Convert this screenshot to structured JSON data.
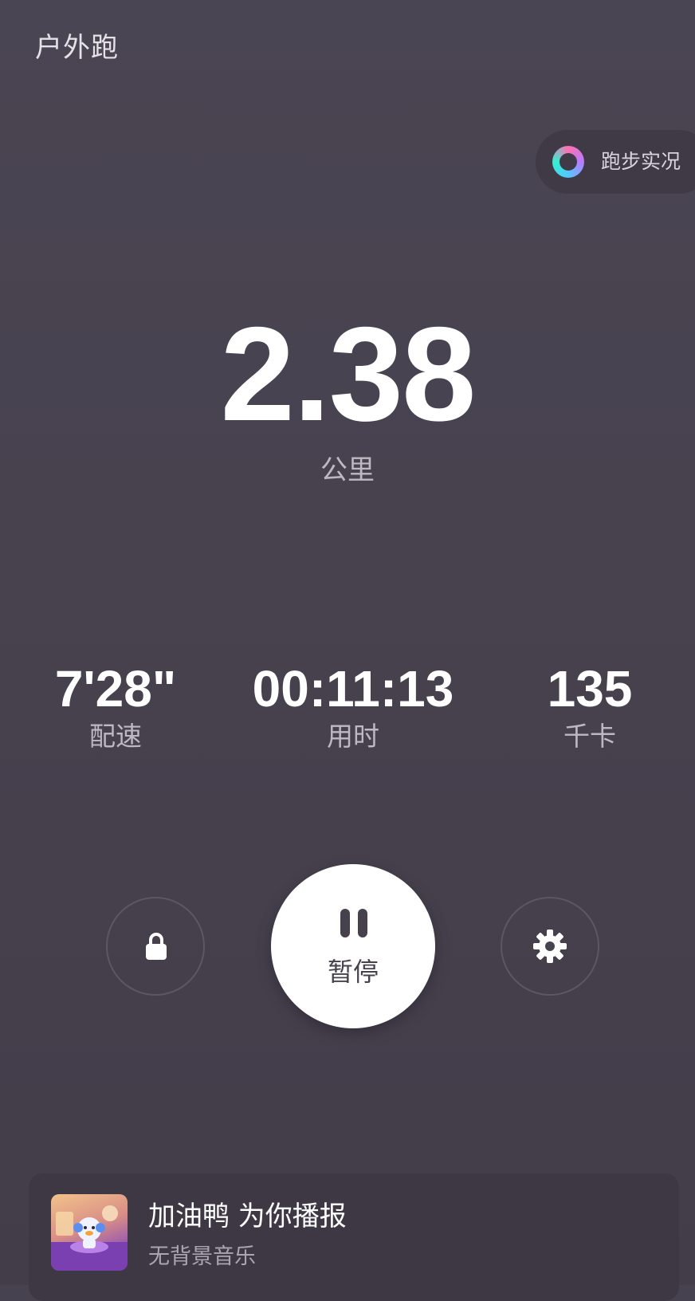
{
  "header": {
    "title": "户外跑"
  },
  "live_status": {
    "label": "跑步实况",
    "icon": "ring-icon"
  },
  "distance": {
    "value": "2.38",
    "unit": "公里"
  },
  "stats": {
    "pace": {
      "value": "7'28\"",
      "label": "配速"
    },
    "duration": {
      "value": "00:11:13",
      "label": "用时"
    },
    "calories": {
      "value": "135",
      "label": "千卡"
    }
  },
  "controls": {
    "lock_icon": "lock-icon",
    "pause_label": "暂停",
    "pause_icon": "pause-icon",
    "settings_icon": "gear-icon"
  },
  "coach": {
    "title": "加油鸭 为你播报",
    "subtitle": "无背景音乐"
  },
  "colors": {
    "background": "#47424f",
    "card": "#3d3844",
    "primary_button": "#ffffff",
    "secondary_text": "#bdb8c2"
  }
}
